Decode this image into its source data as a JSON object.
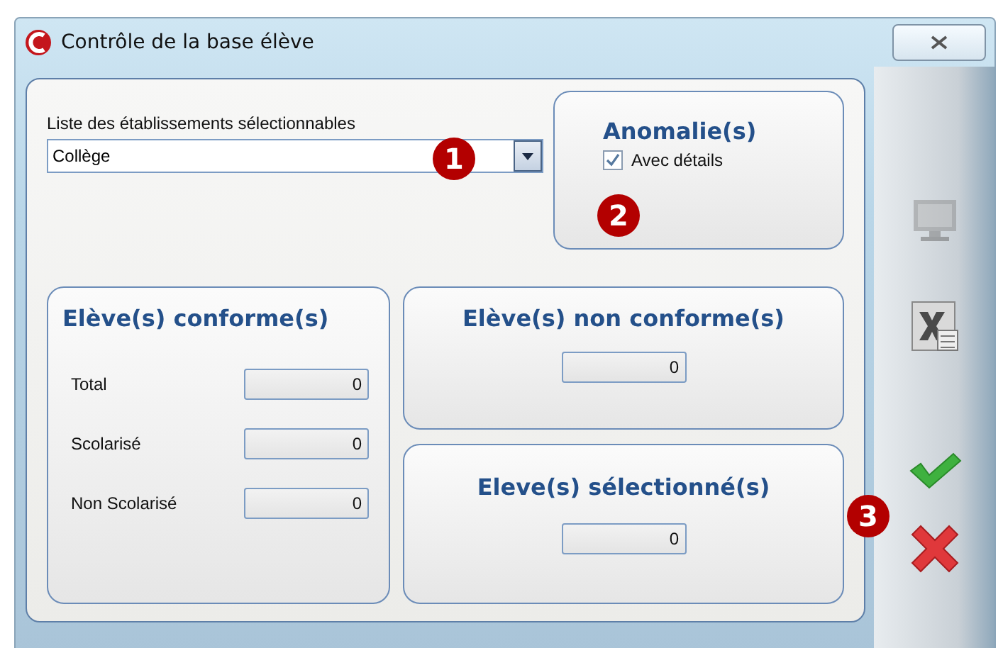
{
  "window": {
    "title": "Contrôle de la base élève"
  },
  "establishments": {
    "label": "Liste des établissements sélectionnables",
    "value": "Collège"
  },
  "anomalies": {
    "title": "Anomalie(s)",
    "details": {
      "label": "Avec détails",
      "checked": true
    }
  },
  "conforming": {
    "title": "Elève(s) conforme(s)",
    "rows": [
      {
        "label": "Total",
        "value": "0"
      },
      {
        "label": "Scolarisé",
        "value": "0"
      },
      {
        "label": "Non Scolarisé",
        "value": "0"
      }
    ]
  },
  "non_conforming": {
    "title": "Elève(s) non conforme(s)",
    "value": "0"
  },
  "selected": {
    "title": "Eleve(s) sélectionné(s)",
    "value": "0"
  },
  "toolbar": [
    {
      "kind": "monitor",
      "disabled": true
    },
    {
      "kind": "excel",
      "disabled": false
    },
    {
      "kind": "ok",
      "disabled": false
    },
    {
      "kind": "cancel",
      "disabled": false
    }
  ],
  "callouts": [
    "1",
    "2",
    "3"
  ]
}
